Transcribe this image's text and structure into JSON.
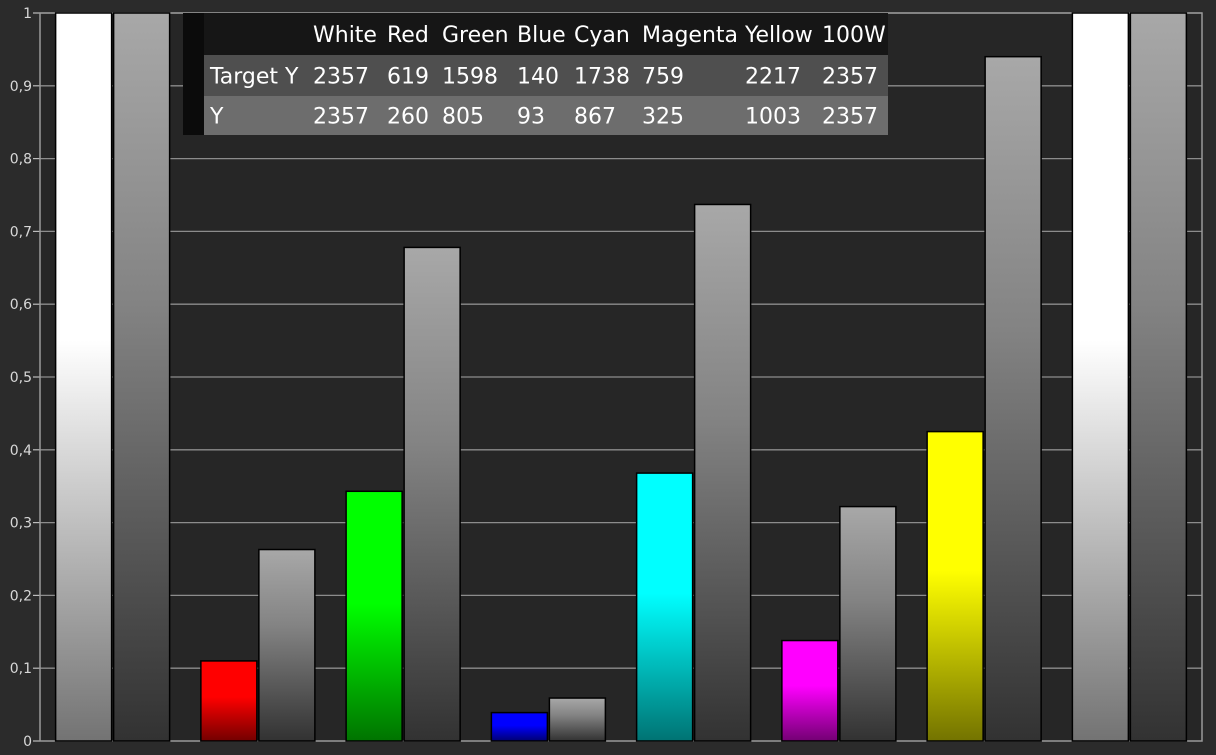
{
  "chart_data": {
    "type": "bar",
    "ylim": [
      0,
      1
    ],
    "yticks": [
      "0",
      "0,1",
      "0,2",
      "0,3",
      "0,4",
      "0,5",
      "0,6",
      "0,7",
      "0,8",
      "0,9",
      "1"
    ],
    "grid": true,
    "categories": [
      "White",
      "Red",
      "Green",
      "Blue",
      "Cyan",
      "Magenta",
      "Yellow",
      "100W"
    ],
    "colors": {
      "White": "#ffffff",
      "Red": "#ff0000",
      "Green": "#00ff00",
      "Blue": "#0000ff",
      "Cyan": "#00ffff",
      "Magenta": "#ff00ff",
      "Yellow": "#ffff00",
      "100W": "#ffffff",
      "reference": "#a8a8a8"
    },
    "series": [
      {
        "values": [
          1.0,
          0.11,
          0.343,
          0.039,
          0.368,
          0.138,
          0.425,
          1.0
        ]
      },
      {
        "values": [
          1.0,
          0.263,
          0.678,
          0.059,
          0.737,
          0.322,
          0.94,
          1.0
        ]
      }
    ],
    "table": {
      "header": [
        "",
        "White",
        "Red",
        "Green",
        "Blue",
        "Cyan",
        "Magenta",
        "Yellow",
        "100W"
      ],
      "rows": [
        [
          "Target Y",
          "2357",
          "619",
          "1598",
          "140",
          "1738",
          "759",
          "2217",
          "2357"
        ],
        [
          "Y",
          "2357",
          "260",
          "805",
          "93",
          "867",
          "325",
          "1003",
          "2357"
        ]
      ]
    }
  }
}
